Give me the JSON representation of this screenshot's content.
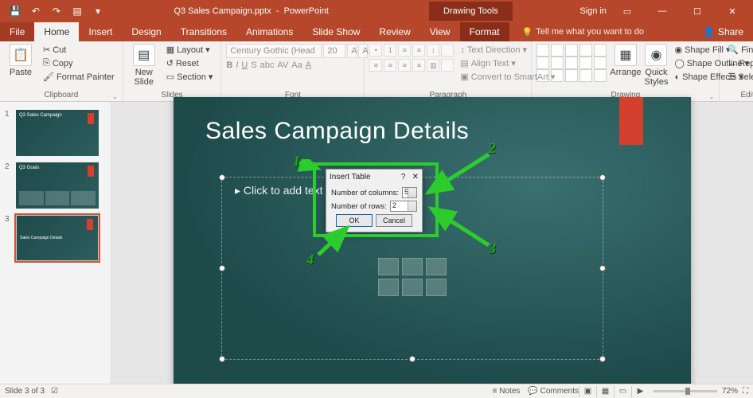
{
  "title": {
    "filename": "Q3 Sales Campaign.pptx",
    "app": "PowerPoint",
    "context_tool": "Drawing Tools",
    "signin": "Sign in"
  },
  "qat": {
    "save": "💾",
    "undo": "↶",
    "redo": "↷",
    "start": "▤"
  },
  "tabs": {
    "file": "File",
    "home": "Home",
    "insert": "Insert",
    "design": "Design",
    "transitions": "Transitions",
    "animations": "Animations",
    "slideshow": "Slide Show",
    "review": "Review",
    "view": "View",
    "format": "Format",
    "tellme": "Tell me what you want to do",
    "share": "Share"
  },
  "ribbon": {
    "clipboard": {
      "paste": "Paste",
      "cut": "Cut",
      "copy": "Copy",
      "painter": "Format Painter",
      "label": "Clipboard"
    },
    "slides": {
      "new": "New\nSlide",
      "layout": "Layout",
      "reset": "Reset",
      "section": "Section",
      "label": "Slides"
    },
    "font": {
      "family": "Century Gothic (Head",
      "size": "20",
      "label": "Font"
    },
    "paragraph": {
      "direction": "Text Direction",
      "align": "Align Text",
      "smartart": "Convert to SmartArt",
      "label": "Paragraph"
    },
    "drawing": {
      "arrange": "Arrange",
      "quick": "Quick\nStyles",
      "fill": "Shape Fill",
      "outline": "Shape Outline",
      "effects": "Shape Effects",
      "label": "Drawing"
    },
    "editing": {
      "find": "Find",
      "replace": "Replace",
      "select": "Select",
      "label": "Editing"
    }
  },
  "thumbnails": [
    {
      "n": "1",
      "title": "Q3 Sales Campaign"
    },
    {
      "n": "2",
      "title": "Q3 Goals"
    },
    {
      "n": "3",
      "title": "Sales Campaign Details"
    }
  ],
  "slide": {
    "title": "Sales Campaign Details",
    "placeholder": "Click to add text",
    "bullet": "▸"
  },
  "dialog": {
    "title": "Insert Table",
    "help": "?",
    "close": "✕",
    "cols_label": "Number of columns:",
    "cols_value": "5",
    "rows_label": "Number of rows:",
    "rows_value": "2",
    "ok": "OK",
    "cancel": "Cancel"
  },
  "annotations": {
    "n1": "1",
    "n2": "2",
    "n3": "3",
    "n4": "4"
  },
  "status": {
    "slide": "Slide 3 of 3",
    "notes": "Notes",
    "comments": "Comments",
    "zoom": "72%"
  }
}
